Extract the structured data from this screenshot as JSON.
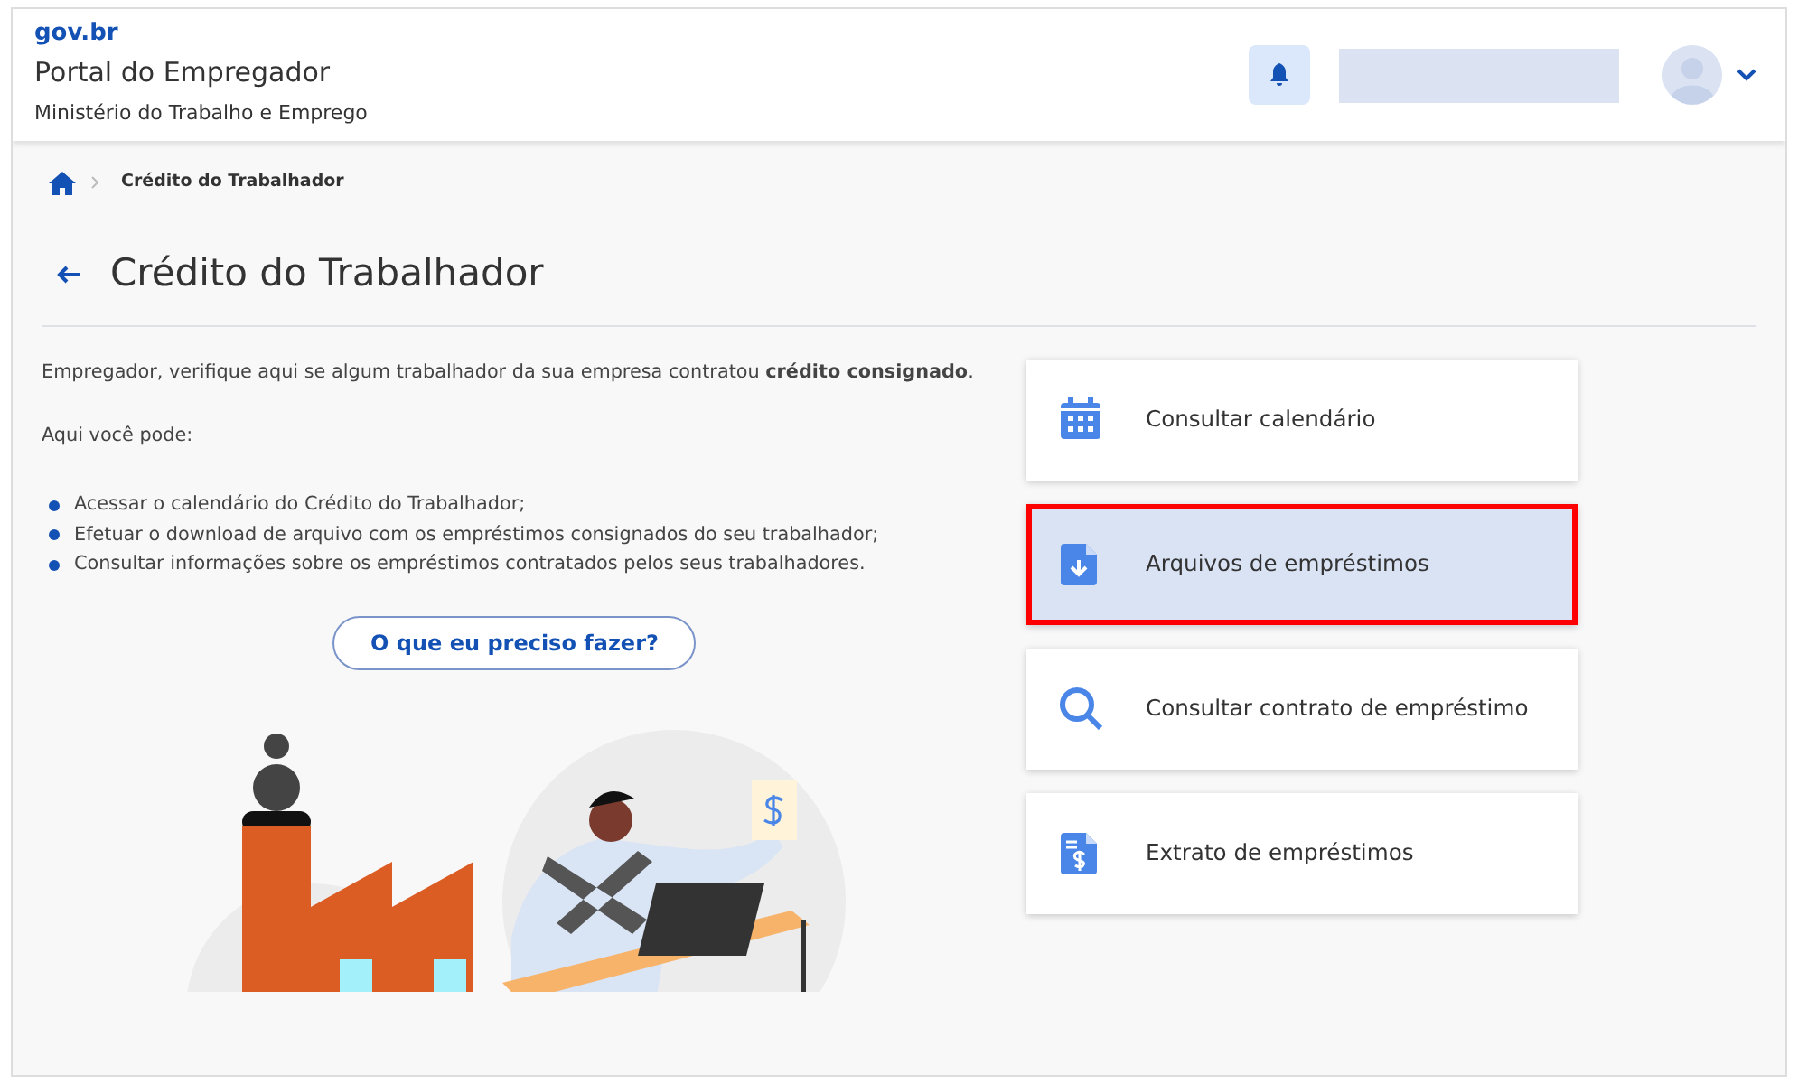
{
  "header": {
    "logo": "gov.br",
    "title": "Portal do Empregador",
    "subtitle": "Ministério do Trabalho e Emprego"
  },
  "breadcrumb": {
    "current": "Crédito do Trabalhador"
  },
  "page_title": "Crédito do Trabalhador",
  "intro": "Empregador, verifique aqui se algum trabalhador da sua empresa contratou **crédito consignado**.",
  "list_heading": "Aqui você pode:",
  "bullets": [
    "Acessar o calendário do Crédito do Trabalhador;",
    "Efetuar o download de arquivo com os empréstimos consignados do seu trabalhador;",
    "Consultar informações sobre os empréstimos contratados pelos seus trabalhadores."
  ],
  "help_button": "O que eu preciso fazer?",
  "options": [
    {
      "label": "Consultar calendário",
      "kind": "calendar",
      "selected": false
    },
    {
      "label": "Arquivos de empréstimos",
      "kind": "download",
      "selected": true
    },
    {
      "label": "Consultar contrato de empréstimo",
      "kind": "search",
      "selected": false
    },
    {
      "label": "Extrato de empréstimos",
      "kind": "statement",
      "selected": false
    }
  ]
}
